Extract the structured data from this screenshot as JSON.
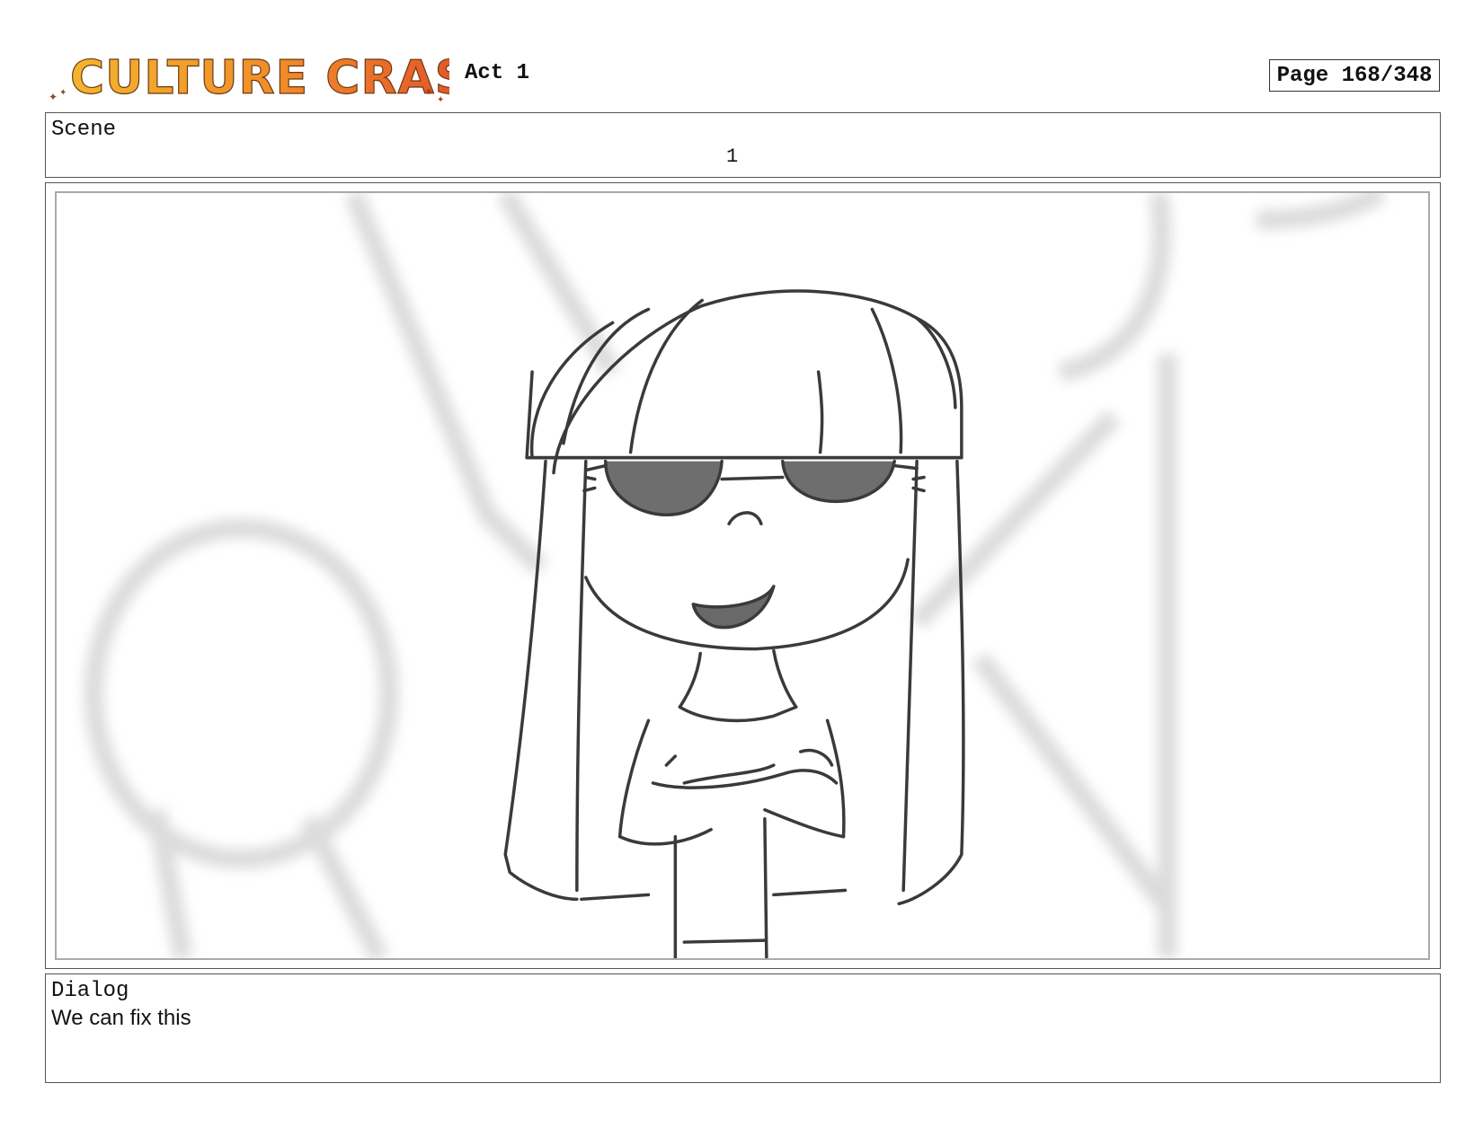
{
  "header": {
    "logo_text": "CULTURE CRASH",
    "act": "Act 1",
    "page": "Page 168/348"
  },
  "scene": {
    "label": "Scene",
    "number": "1"
  },
  "panel": {
    "image_subject": "sketch-girl-sunglasses-arms-crossed"
  },
  "dialog": {
    "label": "Dialog",
    "text": "We can fix this"
  },
  "colors": {
    "logo_orange": "#f2a227",
    "logo_red": "#e2552a",
    "stroke": "#3a3a3a"
  }
}
